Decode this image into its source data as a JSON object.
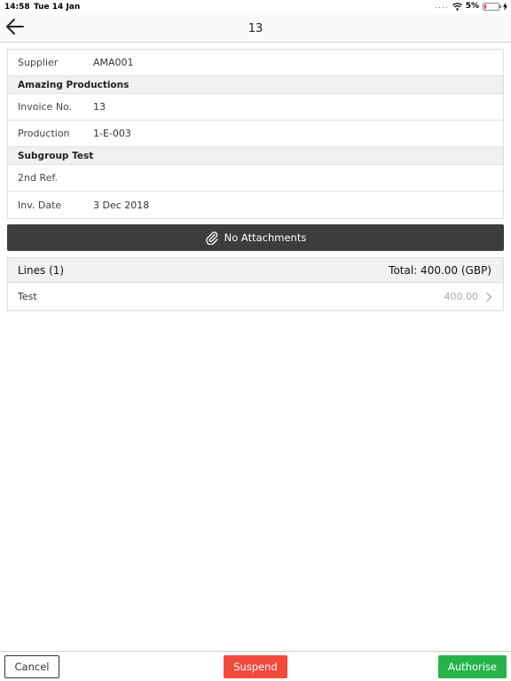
{
  "status_bar": {
    "time": "14:58",
    "date": "Tue 14 Jan",
    "signal_dots": "....",
    "battery": "5%",
    "battery_level_pct": 5
  },
  "nav": {
    "title": "13",
    "back_icon": "arrow-left-icon"
  },
  "details": {
    "supplier_label": "Supplier",
    "supplier_value": "AMA001",
    "supplier_name": "Amazing Productions",
    "invoice_label": "Invoice No.",
    "invoice_value": "13",
    "production_label": "Production",
    "production_value": "1-E-003",
    "subgroup": "Subgroup Test",
    "ref_label": "2nd Ref.",
    "ref_value": "",
    "date_label": "Inv. Date",
    "date_value": "3 Dec 2018"
  },
  "attachments": {
    "label": "No Attachments",
    "icon": "paperclip-icon"
  },
  "lines": {
    "header_label": "Lines (1)",
    "total_label": "Total: 400.00 (GBP)",
    "items": [
      {
        "name": "Test",
        "amount": "400.00"
      }
    ]
  },
  "actions": {
    "cancel": "Cancel",
    "suspend": "Suspend",
    "authorise": "Authorise"
  },
  "colors": {
    "attach_bar": "#3d3d3d",
    "suspend": "#f24a3d",
    "authorise": "#26b34a",
    "battery_low": "#e53935"
  }
}
